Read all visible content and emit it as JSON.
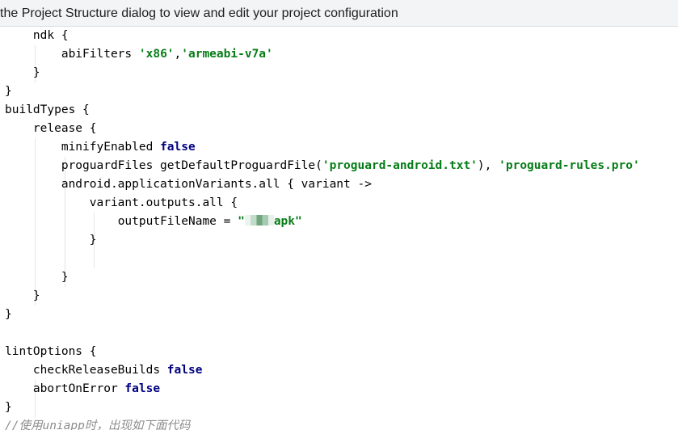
{
  "banner": {
    "text": "the Project Structure dialog to view and edit your project configuration"
  },
  "code": {
    "l1": [
      "ndk {"
    ],
    "l2": [
      "abiFilters ",
      "'x86'",
      ",",
      "'armeabi-v7a'"
    ],
    "l3": [
      "}"
    ],
    "l4": [
      "}"
    ],
    "l5": [
      "buildTypes {"
    ],
    "l6": [
      "release {"
    ],
    "l7": [
      "minifyEnabled ",
      "false"
    ],
    "l8": [
      "proguardFiles getDefaultProguardFile(",
      "'proguard-android.txt'",
      "), ",
      "'proguard-rules.pro'"
    ],
    "l9": [
      "android.applicationVariants.all { variant ->"
    ],
    "l10": [
      "variant.outputs.all {"
    ],
    "l11": [
      "outputFileName = ",
      "\"",
      "apk\""
    ],
    "l12": [
      "}"
    ],
    "l13": [
      "}"
    ],
    "l14": [
      "}"
    ],
    "l15": [
      "}"
    ],
    "l16": [
      "lintOptions {"
    ],
    "l17": [
      "checkReleaseBuilds ",
      "false"
    ],
    "l18": [
      "abortOnError ",
      "false"
    ],
    "l19": [
      "}"
    ],
    "l20": [
      "//使用uniapp时，出现如下面代码"
    ]
  },
  "colors": {
    "keyword": "#000080",
    "string": "#067d17",
    "comment": "#8c8c8c",
    "banner_bg": "#f3f4f6"
  }
}
